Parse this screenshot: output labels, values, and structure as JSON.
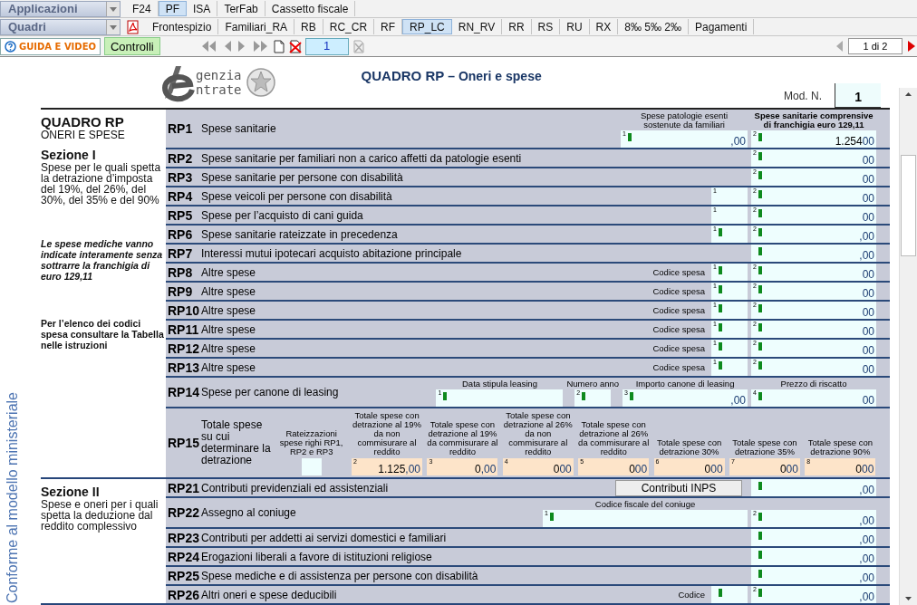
{
  "menus": [
    {
      "label": "Applicazioni",
      "tabs": [
        {
          "label": "F24",
          "selected": false
        },
        {
          "label": "PF",
          "selected": true
        },
        {
          "label": "ISA",
          "selected": false
        },
        {
          "label": "TerFab",
          "selected": false
        },
        {
          "label": "Cassetto fiscale",
          "selected": false
        }
      ]
    },
    {
      "label": "Quadri",
      "tabs": [
        {
          "label": "Frontespizio",
          "selected": false
        },
        {
          "label": "Familiari_RA",
          "selected": false
        },
        {
          "label": "RB",
          "selected": false
        },
        {
          "label": "RC_CR",
          "selected": false
        },
        {
          "label": "RF",
          "selected": false
        },
        {
          "label": "RP_LC",
          "selected": true
        },
        {
          "label": "RN_RV",
          "selected": false
        },
        {
          "label": "RR",
          "selected": false
        },
        {
          "label": "RS",
          "selected": false
        },
        {
          "label": "RU",
          "selected": false
        },
        {
          "label": "RX",
          "selected": false
        },
        {
          "label": "8‰ 5‰ 2‰",
          "selected": false
        },
        {
          "label": "Pagamenti",
          "selected": false
        }
      ]
    }
  ],
  "toolbar": {
    "guide": "GUIDA E VIDEO",
    "checks": "Controlli",
    "page": "1",
    "pager": "1 di 2"
  },
  "header": {
    "logo": [
      "genzia",
      "ntrate"
    ],
    "title": "QUADRO RP",
    "subtitle": "– Oneri e spese",
    "mod_label": "Mod. N.",
    "mod_number": "1"
  },
  "side_note": "Conforme al modello ministeriale",
  "sections": [
    {
      "left": [
        {
          "kind": "title",
          "text": "QUADRO RP"
        },
        {
          "kind": "subtitle",
          "text": "ONERI E SPESE"
        },
        {
          "kind": "section",
          "text": "Sezione I"
        },
        {
          "kind": "body",
          "text": "Spese per le quali spetta la detrazione d’imposta del 19%, del 26%, del 30%, del 35% e del 90%"
        },
        {
          "kind": "note",
          "text": "Le spese mediche vanno indicate interamente senza sottrarre la franchigia di euro 129,11"
        },
        {
          "kind": "hint",
          "text": "Per l’elenco dei codici spesa consultare la Tabella nelle istruzioni"
        }
      ],
      "rows": [
        {
          "kind": "line",
          "code": "RP1",
          "label": "Spese sanitarie",
          "fields": [
            {
              "kind": "wide",
              "number": "1",
              "marker": true,
              "header": "Spese patologie esenti sostenute da familiari",
              "header_bold": false,
              "cents": ",00"
            },
            {
              "kind": "amount",
              "number": "2",
              "marker": true,
              "header": "Spese sanitarie comprensive di franchigia euro 129,11",
              "header_bold": true,
              "value": "1.254",
              "cents": "00"
            }
          ]
        },
        {
          "kind": "line",
          "code": "RP2",
          "label": "Spese sanitarie per familiari non a carico affetti da patologie esenti",
          "fields": [
            {
              "kind": "amount",
              "number": "2",
              "marker": true,
              "cents": "00"
            }
          ]
        },
        {
          "kind": "line",
          "code": "RP3",
          "label": "Spese sanitarie per persone con disabilità",
          "fields": [
            {
              "kind": "amount",
              "number": "2",
              "marker": true,
              "cents": "00"
            }
          ]
        },
        {
          "kind": "line",
          "code": "RP4",
          "label": "Spese veicoli per persone con disabilità",
          "fields": [
            {
              "kind": "code",
              "number": "1",
              "marker": false
            },
            {
              "kind": "amount",
              "number": "2",
              "marker": true,
              "cents": "00"
            }
          ]
        },
        {
          "kind": "line",
          "code": "RP5",
          "label": "Spese per l’acquisto di cani guida",
          "fields": [
            {
              "kind": "code",
              "number": "1",
              "marker": false
            },
            {
              "kind": "amount",
              "number": "2",
              "marker": true,
              "cents": "00"
            }
          ]
        },
        {
          "kind": "line",
          "code": "RP6",
          "label": "Spese sanitarie rateizzate in precedenza",
          "fields": [
            {
              "kind": "code",
              "number": "1",
              "marker": true
            },
            {
              "kind": "amount",
              "number": "2",
              "marker": true,
              "cents": ",00"
            }
          ]
        },
        {
          "kind": "line",
          "code": "RP7",
          "label": "Interessi mutui ipotecari acquisto abitazione principale",
          "fields": [
            {
              "kind": "amount",
              "marker": true,
              "cents": ",00"
            }
          ]
        },
        {
          "kind": "line",
          "code": "RP8",
          "label": "Altre spese",
          "note": "Codice spesa",
          "fields": [
            {
              "kind": "code",
              "number": "1",
              "marker": true
            },
            {
              "kind": "amount",
              "number": "2",
              "marker": true,
              "cents": "00"
            }
          ]
        },
        {
          "kind": "line",
          "code": "RP9",
          "label": "Altre spese",
          "note": "Codice spesa",
          "fields": [
            {
              "kind": "code",
              "number": "1",
              "marker": true
            },
            {
              "kind": "amount",
              "number": "2",
              "marker": true,
              "cents": "00"
            }
          ]
        },
        {
          "kind": "line",
          "code": "RP10",
          "label": "Altre spese",
          "note": "Codice spesa",
          "fields": [
            {
              "kind": "code",
              "number": "1",
              "marker": true
            },
            {
              "kind": "amount",
              "number": "2",
              "marker": true,
              "cents": "00"
            }
          ]
        },
        {
          "kind": "line",
          "code": "RP11",
          "label": "Altre spese",
          "note": "Codice spesa",
          "fields": [
            {
              "kind": "code",
              "number": "1",
              "marker": true
            },
            {
              "kind": "amount",
              "number": "2",
              "marker": true,
              "cents": "00"
            }
          ]
        },
        {
          "kind": "line",
          "code": "RP12",
          "label": "Altre spese",
          "note": "Codice spesa",
          "fields": [
            {
              "kind": "code",
              "number": "1",
              "marker": true
            },
            {
              "kind": "amount",
              "number": "2",
              "marker": true,
              "cents": "00"
            }
          ]
        },
        {
          "kind": "line",
          "code": "RP13",
          "label": "Altre spese",
          "note": "Codice spesa",
          "fields": [
            {
              "kind": "code",
              "number": "1",
              "marker": true
            },
            {
              "kind": "amount",
              "number": "2",
              "marker": true,
              "cents": "00"
            }
          ]
        },
        {
          "kind": "line",
          "code": "RP14",
          "label": "Spese per canone di leasing",
          "fields": [
            {
              "kind": "wide",
              "number": "1",
              "marker": true,
              "header": "Data stipula leasing"
            },
            {
              "kind": "code",
              "number": "2",
              "marker": true,
              "header": "Numero anno"
            },
            {
              "kind": "amount",
              "number": "3",
              "marker": true,
              "header": "Importo canone di leasing",
              "cents": ",00"
            },
            {
              "kind": "amount",
              "number": "4",
              "marker": true,
              "header": "Prezzo di riscatto",
              "cents": "00"
            }
          ]
        },
        {
          "kind": "totals",
          "code": "RP15",
          "label": "Totale spese su cui determinare la detrazione",
          "fields": [
            {
              "kind": "blank",
              "header": "Rateizzazioni spese righi RP1, RP2 e RP3"
            },
            {
              "kind": "total",
              "header": "Totale spese con detrazione al 19% da non commisurare al reddito",
              "number": "2",
              "value": "1.125",
              "cents": ",00"
            },
            {
              "kind": "total",
              "header": "Totale spese con detrazione al 19% da commisurare al reddito",
              "number": "3",
              "value": "0",
              "cents": ",00"
            },
            {
              "kind": "total",
              "header": "Totale spese con detrazione al 26% da non commisurare al reddito",
              "number": "4",
              "value": "0",
              "cents": "00"
            },
            {
              "kind": "total",
              "header": "Totale spese con detrazione al 26% da commisurare al reddito",
              "number": "5",
              "value": "0",
              "cents": "00"
            },
            {
              "kind": "total",
              "header": "Totale spese con detrazione 30%",
              "number": "6",
              "value": "0",
              "cents": "00"
            },
            {
              "kind": "total",
              "header": "Totale spese con detrazione 35%",
              "number": "7",
              "value": "0",
              "cents": "00"
            },
            {
              "kind": "total",
              "header": "Totale spese con detrazione 90%",
              "number": "8",
              "value": "0",
              "cents": "00"
            }
          ]
        }
      ]
    },
    {
      "left": [
        {
          "kind": "section",
          "text": "Sezione II"
        },
        {
          "kind": "body",
          "text": "Spese e oneri per i quali spetta la deduzione dal reddito complessivo"
        }
      ],
      "rows": [
        {
          "kind": "line",
          "code": "RP21",
          "label": "Contributi previdenziali ed assistenziali",
          "fields": [
            {
              "kind": "button",
              "label": "Contributi INPS"
            },
            {
              "kind": "amount",
              "marker": true,
              "cents": ",00"
            }
          ]
        },
        {
          "kind": "line",
          "code": "RP22",
          "label": "Assegno al coniuge",
          "fields": [
            {
              "kind": "xwide",
              "number": "1",
              "marker": true,
              "header": "Codice fiscale del coniuge"
            },
            {
              "kind": "amount",
              "number": "2",
              "marker": true,
              "cents": ",00"
            }
          ]
        },
        {
          "kind": "line",
          "code": "RP23",
          "label": "Contributi per addetti ai servizi domestici e familiari",
          "fields": [
            {
              "kind": "amount",
              "marker": true,
              "cents": ",00"
            }
          ]
        },
        {
          "kind": "line",
          "code": "RP24",
          "label": "Erogazioni liberali a favore di istituzioni religiose",
          "fields": [
            {
              "kind": "amount",
              "marker": true,
              "cents": ",00"
            }
          ]
        },
        {
          "kind": "line",
          "code": "RP25",
          "label": "Spese mediche e di assistenza per persone con disabilità",
          "fields": [
            {
              "kind": "amount",
              "marker": true,
              "cents": ",00"
            }
          ]
        },
        {
          "kind": "line",
          "code": "RP26",
          "label": "Altri oneri e spese deducibili",
          "note": "Codice",
          "fields": [
            {
              "kind": "code",
              "marker": true
            },
            {
              "kind": "amount",
              "number": "2",
              "marker": true,
              "cents": ",00"
            }
          ]
        }
      ]
    }
  ]
}
